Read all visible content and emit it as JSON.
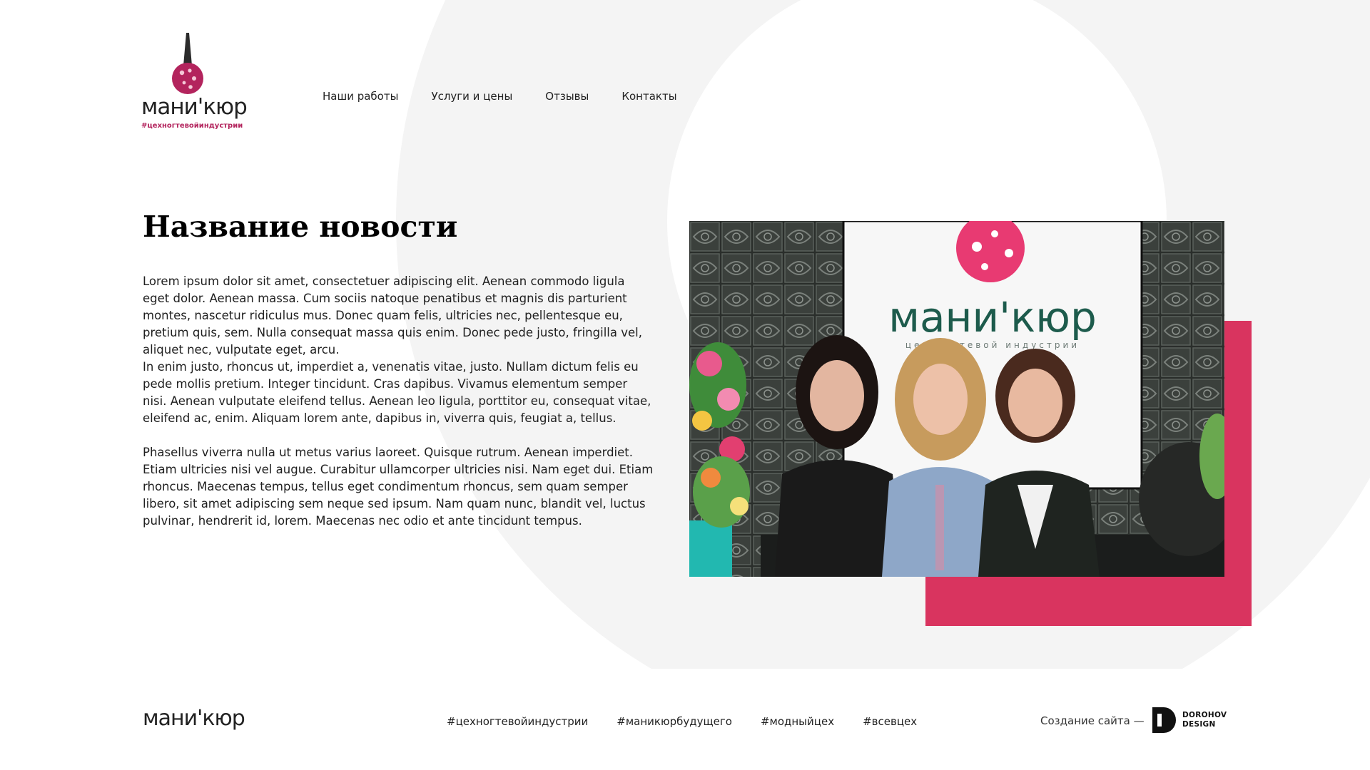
{
  "brand": {
    "name": "мани'кюр",
    "tagline": "#цехногтевойиндустрии",
    "accent_color": "#d9345f",
    "logo_icon": "nail-polish-bottle-icon"
  },
  "nav": {
    "items": [
      {
        "label": "Наши работы"
      },
      {
        "label": "Услуги и цены"
      },
      {
        "label": "Отзывы"
      },
      {
        "label": "Контакты"
      }
    ]
  },
  "article": {
    "title": "Название новости",
    "paragraphs": [
      "Lorem ipsum dolor sit amet, consectetuer adipiscing elit. Aenean commodo ligula eget dolor. Aenean massa. Cum sociis natoque penatibus et magnis dis parturient montes, nascetur ridiculus mus. Donec quam felis, ultricies nec, pellentesque eu, pretium quis, sem. Nulla consequat massa quis enim. Donec pede justo, fringilla vel, aliquet nec, vulputate eget, arcu.",
      "In enim justo, rhoncus ut, imperdiet a, venenatis vitae, justo. Nullam dictum felis eu pede mollis pretium. Integer tincidunt. Cras dapibus. Vivamus elementum semper nisi. Aenean vulputate eleifend tellus. Aenean leo ligula, porttitor eu, consequat vitae, eleifend ac, enim. Aliquam lorem ante, dapibus in, viverra quis, feugiat a, tellus.",
      "Phasellus viverra nulla ut metus varius laoreet. Quisque rutrum. Aenean imperdiet. Etiam ultricies nisi vel augue. Curabitur ullamcorper ultricies nisi. Nam eget dui. Etiam rhoncus. Maecenas tempus, tellus eget condimentum rhoncus, sem quam semper libero, sit amet adipiscing sem neque sed ipsum. Nam quam nunc, blandit vel, luctus pulvinar, hendrerit id, lorem. Maecenas nec odio et ante tincidunt tempus."
    ],
    "photo": {
      "sign_text": "мани'кюр",
      "sign_subtext": "цех ногтевой индустрии"
    }
  },
  "footer": {
    "logo": "мани'кюр",
    "tags": [
      {
        "label": "#цехногтевойиндустрии"
      },
      {
        "label": "#маникюрбудущего"
      },
      {
        "label": "#модныйцех"
      },
      {
        "label": "#всевцех"
      }
    ],
    "credit": "Создание сайта —",
    "studio_line1": "DOROHOV",
    "studio_line2": "DESIGN"
  }
}
